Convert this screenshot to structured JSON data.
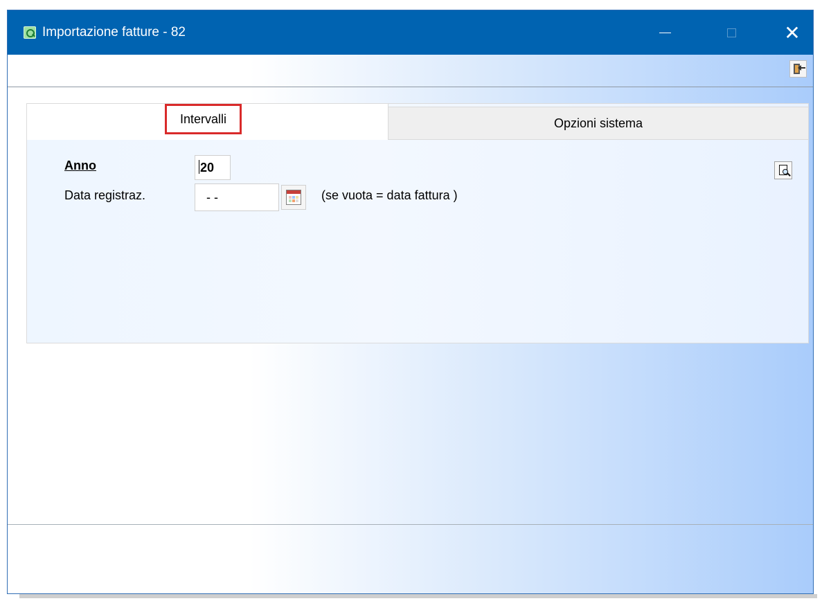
{
  "window": {
    "title": "Importazione fatture - 82",
    "controls": {
      "minimize": "—",
      "maximize": "□",
      "close": "✕"
    }
  },
  "toolbar": {
    "exit_icon": "exit-door-icon"
  },
  "tabs": [
    {
      "label": "Intervalli",
      "active": true,
      "highlight_color": "#d92a2a"
    },
    {
      "label": "Opzioni sistema",
      "active": false
    }
  ],
  "form": {
    "anno_label": "Anno",
    "anno_value": "20",
    "data_label": "Data registraz.",
    "data_value": "- -",
    "data_hint": "(se vuota = data fattura )"
  },
  "icons": {
    "app": "app-search-icon",
    "calendar": "calendar-icon",
    "search": "document-search-icon"
  },
  "colors": {
    "titlebar": "#0063b1",
    "window_gradient_end": "#a9ccfb",
    "active_tab_outline": "#d92a2a"
  }
}
